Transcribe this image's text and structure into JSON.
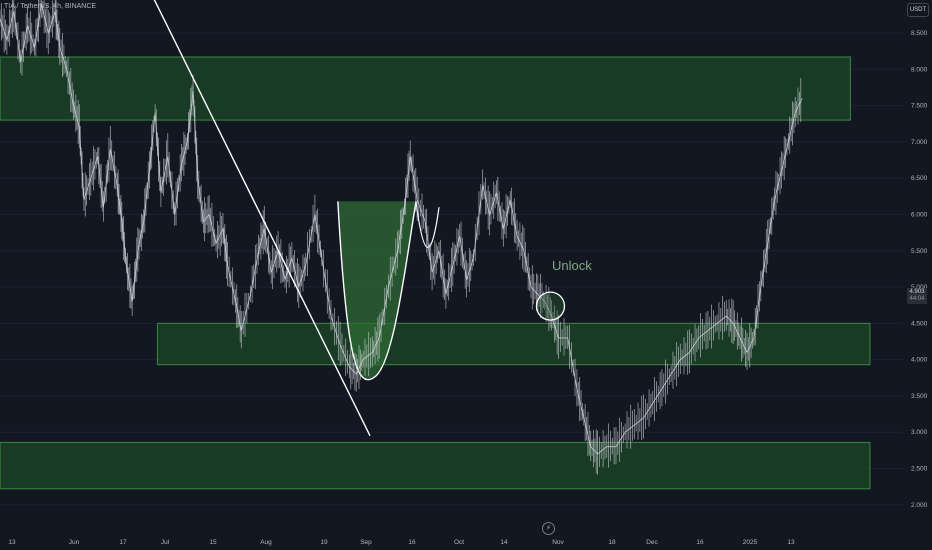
{
  "header": {
    "symbol": "TIA / TetherUS, 4h, BINANCE"
  },
  "currency": "USDT",
  "last_price": {
    "value": "4.903",
    "countdown": "44:04"
  },
  "annotation": {
    "unlock_label": "Unlock"
  },
  "event_icon": "lightning-icon",
  "colors": {
    "background": "#131722",
    "candles": "#d1d4dc",
    "zone_fill": "#1e5128",
    "zone_border": "#4caf50",
    "cup_fill": "#2e6b34",
    "trendline": "#ffffff",
    "axis_text": "#b2b5be",
    "unlock_text": "#7fa882"
  },
  "chart_data": {
    "type": "line",
    "title": "",
    "xlabel": "",
    "ylabel": "",
    "ylim": [
      1.9,
      9.0
    ],
    "y_ticks": [
      "2.000",
      "2.500",
      "3.000",
      "3.500",
      "4.000",
      "4.500",
      "5.000",
      "5.500",
      "6.000",
      "6.500",
      "7.000",
      "7.500",
      "8.000",
      "8.500"
    ],
    "x_ticks": [
      "13",
      "Jun",
      "17",
      "Jul",
      "15",
      "Aug",
      "19",
      "Sep",
      "16",
      "Oct",
      "14",
      "Nov",
      "18",
      "Dec",
      "16",
      "2025",
      "13"
    ],
    "series": [
      {
        "role": "price",
        "points": [
          [
            0,
            8.7
          ],
          [
            0.6,
            8.4
          ],
          [
            1.2,
            8.8
          ],
          [
            1.8,
            8.1
          ],
          [
            2.4,
            8.6
          ],
          [
            3.0,
            8.3
          ],
          [
            3.6,
            8.9
          ],
          [
            4.2,
            8.5
          ],
          [
            4.8,
            8.8
          ],
          [
            5.2,
            8.3
          ],
          [
            5.8,
            8.0
          ],
          [
            6.4,
            7.5
          ],
          [
            6.9,
            7.2
          ],
          [
            7.3,
            6.2
          ],
          [
            7.9,
            6.5
          ],
          [
            8.5,
            6.8
          ],
          [
            9.0,
            6.1
          ],
          [
            9.6,
            6.9
          ],
          [
            10.2,
            6.4
          ],
          [
            10.6,
            5.9
          ],
          [
            11.0,
            5.3
          ],
          [
            11.5,
            4.8
          ],
          [
            12.0,
            5.5
          ],
          [
            12.5,
            5.9
          ],
          [
            13.0,
            6.6
          ],
          [
            13.5,
            7.4
          ],
          [
            14.0,
            6.3
          ],
          [
            14.6,
            6.8
          ],
          [
            15.2,
            6.0
          ],
          [
            15.8,
            6.7
          ],
          [
            16.3,
            7.0
          ],
          [
            16.8,
            7.7
          ],
          [
            17.2,
            6.5
          ],
          [
            17.7,
            5.9
          ],
          [
            18.2,
            6.0
          ],
          [
            18.8,
            5.6
          ],
          [
            19.4,
            5.8
          ],
          [
            19.8,
            5.3
          ],
          [
            20.5,
            4.8
          ],
          [
            21.0,
            4.4
          ],
          [
            21.8,
            4.9
          ],
          [
            22.5,
            5.5
          ],
          [
            23.0,
            5.8
          ],
          [
            23.6,
            5.2
          ],
          [
            24.2,
            5.5
          ],
          [
            24.8,
            5.1
          ],
          [
            25.4,
            5.4
          ],
          [
            26.0,
            5.0
          ],
          [
            26.6,
            5.3
          ],
          [
            27.4,
            6.0
          ],
          [
            28.0,
            5.4
          ],
          [
            28.8,
            4.6
          ],
          [
            29.6,
            4.2
          ],
          [
            30.4,
            3.9
          ],
          [
            31.0,
            3.8
          ],
          [
            31.6,
            4.0
          ],
          [
            32.4,
            4.1
          ],
          [
            33.0,
            4.3
          ],
          [
            33.8,
            5.0
          ],
          [
            34.6,
            5.5
          ],
          [
            35.2,
            6.1
          ],
          [
            35.7,
            6.8
          ],
          [
            36.3,
            6.2
          ],
          [
            37.0,
            5.9
          ],
          [
            37.6,
            5.2
          ],
          [
            38.2,
            5.5
          ],
          [
            38.8,
            4.9
          ],
          [
            39.4,
            5.3
          ],
          [
            40.0,
            5.7
          ],
          [
            40.6,
            5.1
          ],
          [
            41.2,
            5.4
          ],
          [
            42.0,
            6.4
          ],
          [
            42.6,
            6.0
          ],
          [
            43.2,
            6.3
          ],
          [
            43.8,
            5.8
          ],
          [
            44.4,
            6.2
          ],
          [
            45.0,
            5.7
          ],
          [
            45.6,
            5.5
          ],
          [
            46.2,
            5.0
          ],
          [
            46.8,
            4.9
          ],
          [
            47.4,
            4.8
          ],
          [
            48.0,
            4.6
          ],
          [
            48.6,
            4.3
          ],
          [
            49.4,
            4.3
          ],
          [
            50.2,
            3.6
          ],
          [
            50.8,
            3.2
          ],
          [
            51.4,
            2.8
          ],
          [
            52.0,
            2.7
          ],
          [
            52.8,
            2.8
          ],
          [
            53.6,
            2.8
          ],
          [
            54.4,
            3.0
          ],
          [
            55.2,
            3.1
          ],
          [
            56.0,
            3.2
          ],
          [
            56.8,
            3.4
          ],
          [
            57.6,
            3.6
          ],
          [
            58.4,
            3.8
          ],
          [
            59.2,
            4.0
          ],
          [
            60.0,
            4.1
          ],
          [
            60.8,
            4.3
          ],
          [
            61.6,
            4.4
          ],
          [
            62.4,
            4.5
          ],
          [
            63.2,
            4.6
          ],
          [
            63.8,
            4.5
          ],
          [
            64.4,
            4.3
          ],
          [
            65.0,
            4.1
          ],
          [
            65.6,
            4.3
          ],
          [
            66.2,
            5.0
          ],
          [
            66.8,
            5.6
          ],
          [
            67.4,
            6.2
          ],
          [
            68.0,
            6.6
          ],
          [
            68.6,
            7.0
          ],
          [
            69.2,
            7.4
          ],
          [
            69.8,
            7.6
          ]
        ]
      }
    ],
    "zones": [
      {
        "name": "",
        "y_low": 7.3,
        "y_high": 8.17,
        "x_start": 0,
        "x_end": 74
      },
      {
        "name": "",
        "y_low": 3.93,
        "y_high": 4.5,
        "x_start": 13.7,
        "x_end": 75.7
      },
      {
        "name": "",
        "y_low": 2.22,
        "y_high": 2.86,
        "x_start": 0,
        "x_end": 75.7
      }
    ],
    "trendline": {
      "from": [
        13.3,
        9.0
      ],
      "to": [
        32.2,
        2.95
      ]
    },
    "cup_pattern": {
      "left_rim": [
        29.4,
        6.18
      ],
      "bottom": [
        32.5,
        3.75
      ],
      "right_rim": [
        36.2,
        6.18
      ],
      "handle_low": [
        37.2,
        5.2
      ],
      "handle_right": [
        38.2,
        6.1
      ]
    },
    "unlock_marker": {
      "x": 47.9,
      "y": 4.82
    }
  }
}
